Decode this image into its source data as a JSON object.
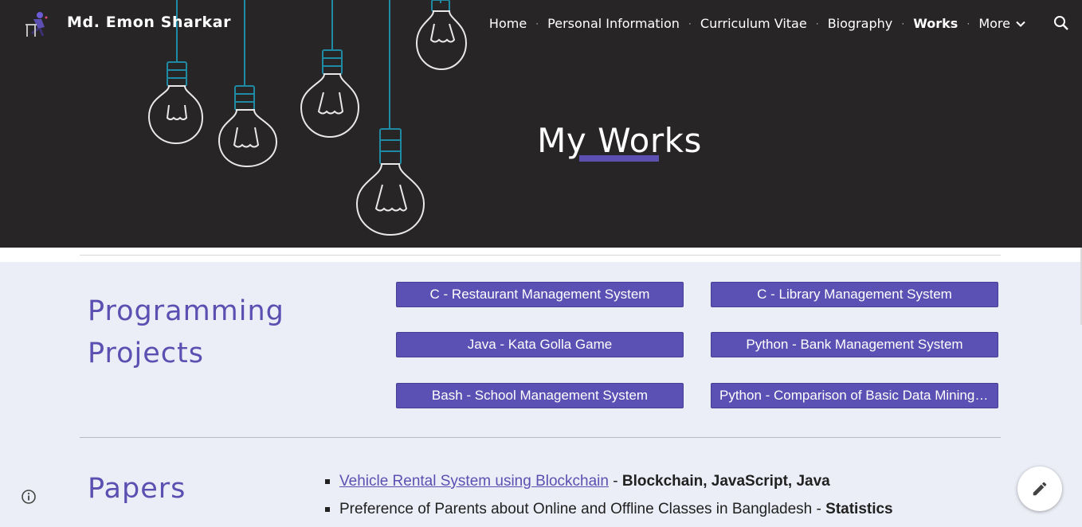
{
  "header": {
    "site_title": "Md. Emon Sharkar",
    "nav": [
      {
        "label": "Home",
        "active": false
      },
      {
        "label": "Personal Information",
        "active": false
      },
      {
        "label": "Curriculum Vitae",
        "active": false
      },
      {
        "label": "Biography",
        "active": false
      },
      {
        "label": "Works",
        "active": true
      },
      {
        "label": "More",
        "active": false
      }
    ],
    "separator": "·",
    "search_icon": "search-icon",
    "more_icon": "chevron-down-icon"
  },
  "hero": {
    "title": "My Works",
    "accent": "#5b4fb1",
    "background": "#282526"
  },
  "projects": {
    "heading_line1": "Programming",
    "heading_line2": "Projects",
    "buttons": [
      "C - Restaurant Management System",
      "C - Library Management System",
      "Java - Kata Golla Game",
      "Python - Bank Management System",
      "Bash - School Management System",
      "Python - Comparison of Basic Data Mining ..."
    ],
    "button_color": "#5b50b3"
  },
  "papers": {
    "heading": "Papers",
    "items": [
      {
        "title": "Vehicle Rental System using Blockchain",
        "sep": " - ",
        "tags": "Blockchain, JavaScript, Java",
        "link": true
      },
      {
        "title": "Preference of Parents about Online and Offline Classes in Bangladesh",
        "sep": " - ",
        "tags": "Statistics",
        "link": false
      }
    ]
  },
  "floating": {
    "info_icon": "info-icon",
    "edit_icon": "pencil-icon"
  }
}
